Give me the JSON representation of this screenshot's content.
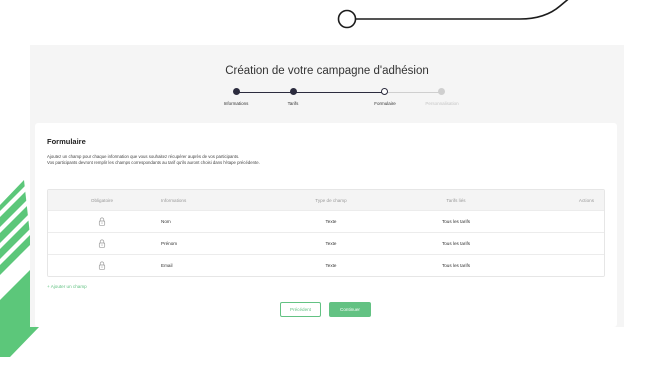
{
  "page": {
    "title": "Création de votre campagne d'adhésion"
  },
  "steps": [
    {
      "label": "Informations",
      "state": "done"
    },
    {
      "label": "Tarifs",
      "state": "done"
    },
    {
      "label": "Formulaire",
      "state": "current"
    },
    {
      "label": "Personnalisation",
      "state": "future"
    }
  ],
  "form": {
    "title": "Formulaire",
    "description_line1": "Ajoutez un champ pour chaque information que vous souhaitez récupérer auprès de vos participants.",
    "description_line2": "Vos participants devront remplir les champs correspondants au tarif qu'ils auront choisi dans l'étape précédente."
  },
  "table": {
    "headers": [
      "Obligatoire",
      "Informations",
      "Type de champ",
      "Tarifs liés",
      "Actions"
    ],
    "rows": [
      {
        "lock_icon": "lock-icon",
        "information": "Nom",
        "type": "Texte",
        "tarifs": "Tous les tarifs"
      },
      {
        "lock_icon": "lock-icon",
        "information": "Prénom",
        "type": "Texte",
        "tarifs": "Tous les tarifs"
      },
      {
        "lock_icon": "lock-icon",
        "information": "Email",
        "type": "Texte",
        "tarifs": "Tous les tarifs"
      }
    ]
  },
  "add_field_label": "+ Ajouter un champ",
  "buttons": {
    "previous": "Précédent",
    "next": "Continuer"
  },
  "colors": {
    "accent": "#63c283",
    "stepper_dark": "#2c2c3e",
    "decor_green": "#5cc77a",
    "panel_bg": "#f5f5f5"
  }
}
